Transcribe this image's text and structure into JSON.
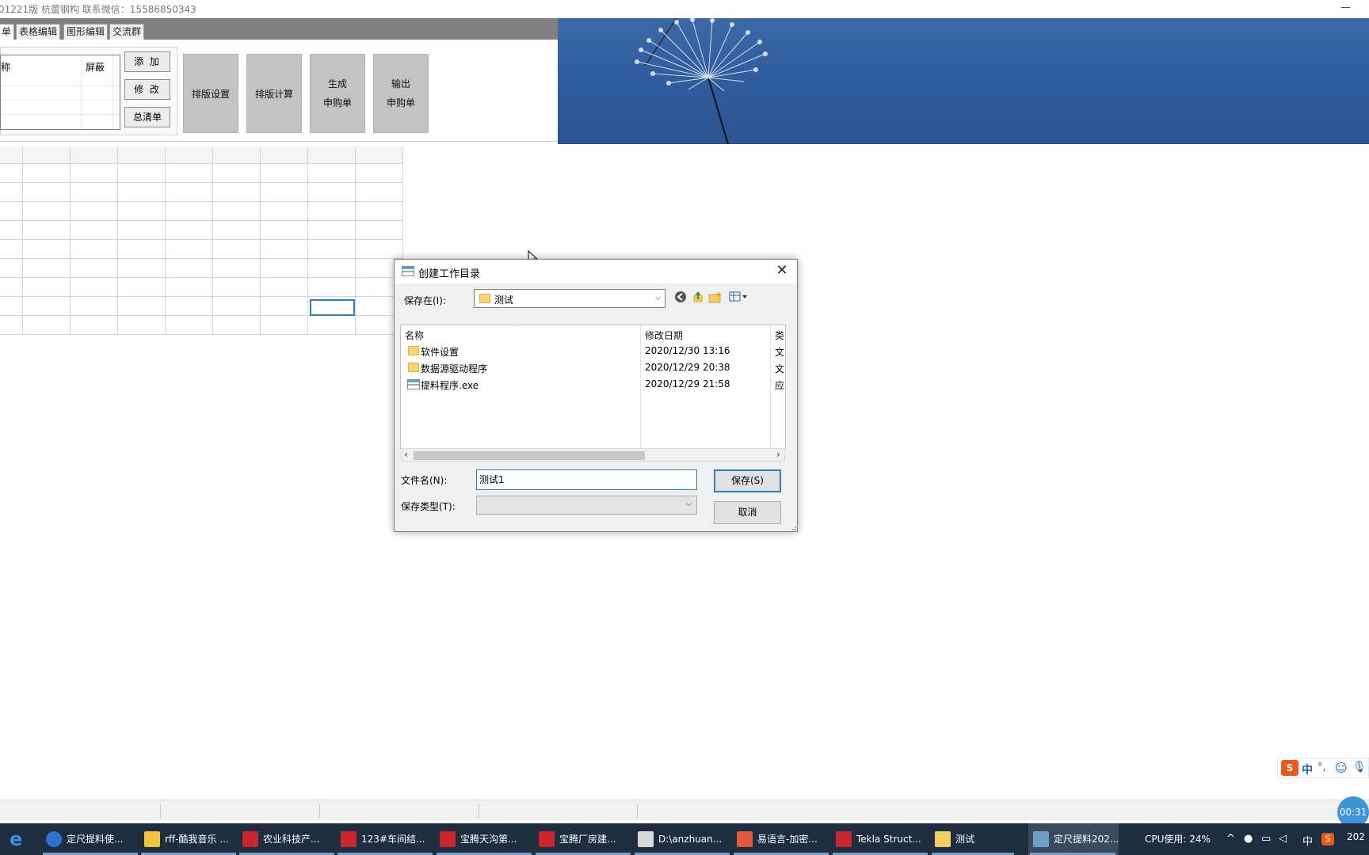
{
  "window": {
    "title": "01221版 杭蕾钢构 联系微信：15586850343",
    "minimize_label": "—"
  },
  "tabs": [
    {
      "label": "单",
      "active": true
    },
    {
      "label": "表格编辑",
      "active": false
    },
    {
      "label": "图形编辑",
      "active": false
    },
    {
      "label": "交流群",
      "active": false
    }
  ],
  "mini_list": {
    "col_name": "称",
    "col_hide": "屏蔽"
  },
  "side_buttons": {
    "add": "添 加",
    "modify": "修 改",
    "clear_all": "总清单"
  },
  "big_buttons": {
    "layout_settings": "排版设置",
    "layout_calc": "排版计算",
    "gen_line1": "生成",
    "gen_line2": "申购单",
    "out_line1": "输出",
    "out_line2": "申购单"
  },
  "dialog": {
    "title": "创建工作目录",
    "save_in_label": "保存在(I):",
    "save_in_value": "测试",
    "columns": {
      "name": "名称",
      "modified": "修改日期",
      "type": "类"
    },
    "files": [
      {
        "name": "软件设置",
        "modified": "2020/12/30 13:16",
        "type": "文",
        "icon": "folder-icon"
      },
      {
        "name": "数据源驱动程序",
        "modified": "2020/12/29 20:38",
        "type": "文",
        "icon": "folder-icon"
      },
      {
        "name": "提料程序.exe",
        "modified": "2020/12/29 21:58",
        "type": "应",
        "icon": "exe-icon"
      }
    ],
    "filename_label": "文件名(N):",
    "filename_value": "测试1",
    "filetype_label": "保存类型(T):",
    "filetype_value": "",
    "save_button": "保存(S)",
    "cancel_button": "取消"
  },
  "ime": {
    "mode": "中",
    "punct": "°,"
  },
  "timer": "00:31",
  "taskbar": {
    "items": [
      {
        "label": "定尺提料使..."
      },
      {
        "label": "rff-酷我音乐 ..."
      },
      {
        "label": "农业科技产..."
      },
      {
        "label": "123#车间结..."
      },
      {
        "label": "宝腾天沟第..."
      },
      {
        "label": "宝腾厂房建..."
      },
      {
        "label": "D:\\anzhuan..."
      },
      {
        "label": "易语言-加密..."
      },
      {
        "label": "Tekla Struct..."
      },
      {
        "label": "测试"
      },
      {
        "label": "定尺提料202..."
      }
    ],
    "cpu": "CPU使用: 24%",
    "lang": "中",
    "clock": "202"
  },
  "colors": {
    "banner": "#2f5a9c",
    "taskbar": "#1f2d40",
    "accent": "#2e7fc4"
  }
}
